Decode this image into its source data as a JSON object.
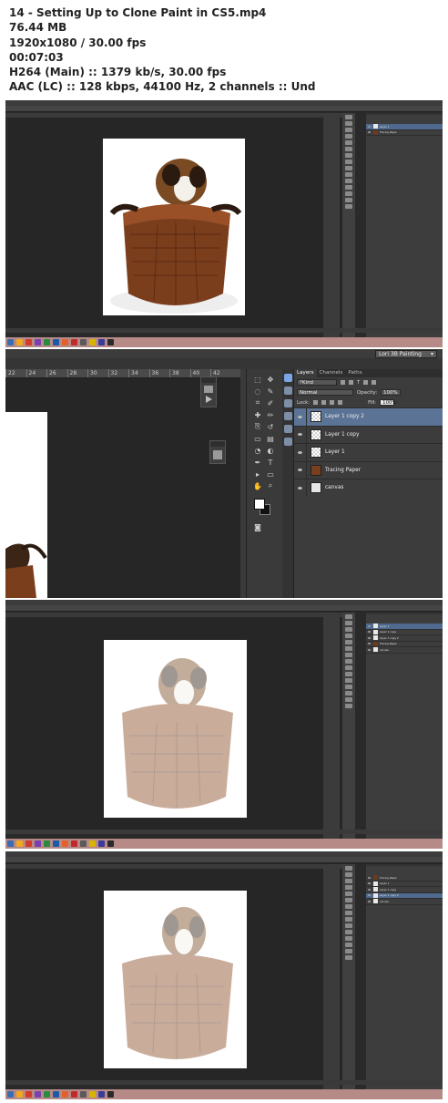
{
  "header": {
    "lines": [
      "14 - Setting Up to Clone Paint in CS5.mp4",
      "76.44 MB",
      "1920x1080 / 30.00 fps",
      "00:07:03",
      "H264 (Main) :: 1379 kb/s, 30.00 fps",
      "AAC (LC) :: 128 kbps, 44100 Hz, 2 channels :: Und"
    ]
  },
  "frame2": {
    "workspace": "Lori 3B Painting",
    "ruler_ticks": [
      "22",
      "24",
      "26",
      "28",
      "30",
      "32",
      "34",
      "36",
      "38",
      "40",
      "42"
    ],
    "panel_tabs": [
      "Layers",
      "Channels",
      "Paths"
    ],
    "kind_label": "Kind",
    "blend_mode": "Normal",
    "opacity_label": "Opacity:",
    "opacity_value": "100%",
    "lock_label": "Lock:",
    "fill_label": "Fill:",
    "fill_value": "100%",
    "layers": [
      {
        "name": "Layer 1 copy 2",
        "selected": true,
        "thumb": "checker"
      },
      {
        "name": "Layer 1 copy",
        "selected": false,
        "thumb": "checker"
      },
      {
        "name": "Layer 1",
        "selected": false,
        "thumb": "checker"
      },
      {
        "name": "Tracing Paper",
        "selected": false,
        "thumb": "photo"
      },
      {
        "name": "canvas",
        "selected": false,
        "thumb": "white"
      }
    ]
  },
  "frames": {
    "f1": {
      "layers": [
        "Layer 1",
        "Tracing Paper"
      ],
      "selected": 0
    },
    "f3": {
      "layers": [
        "Layer 1",
        "Layer 1 copy",
        "Layer 1 copy 2",
        "Tracing Paper",
        "canvas"
      ],
      "selected": 0
    },
    "f4": {
      "layers": [
        "Tracing Paper",
        "Layer 1",
        "Layer 1 copy",
        "Layer 1 copy 2",
        "canvas"
      ],
      "selected": 3
    }
  }
}
